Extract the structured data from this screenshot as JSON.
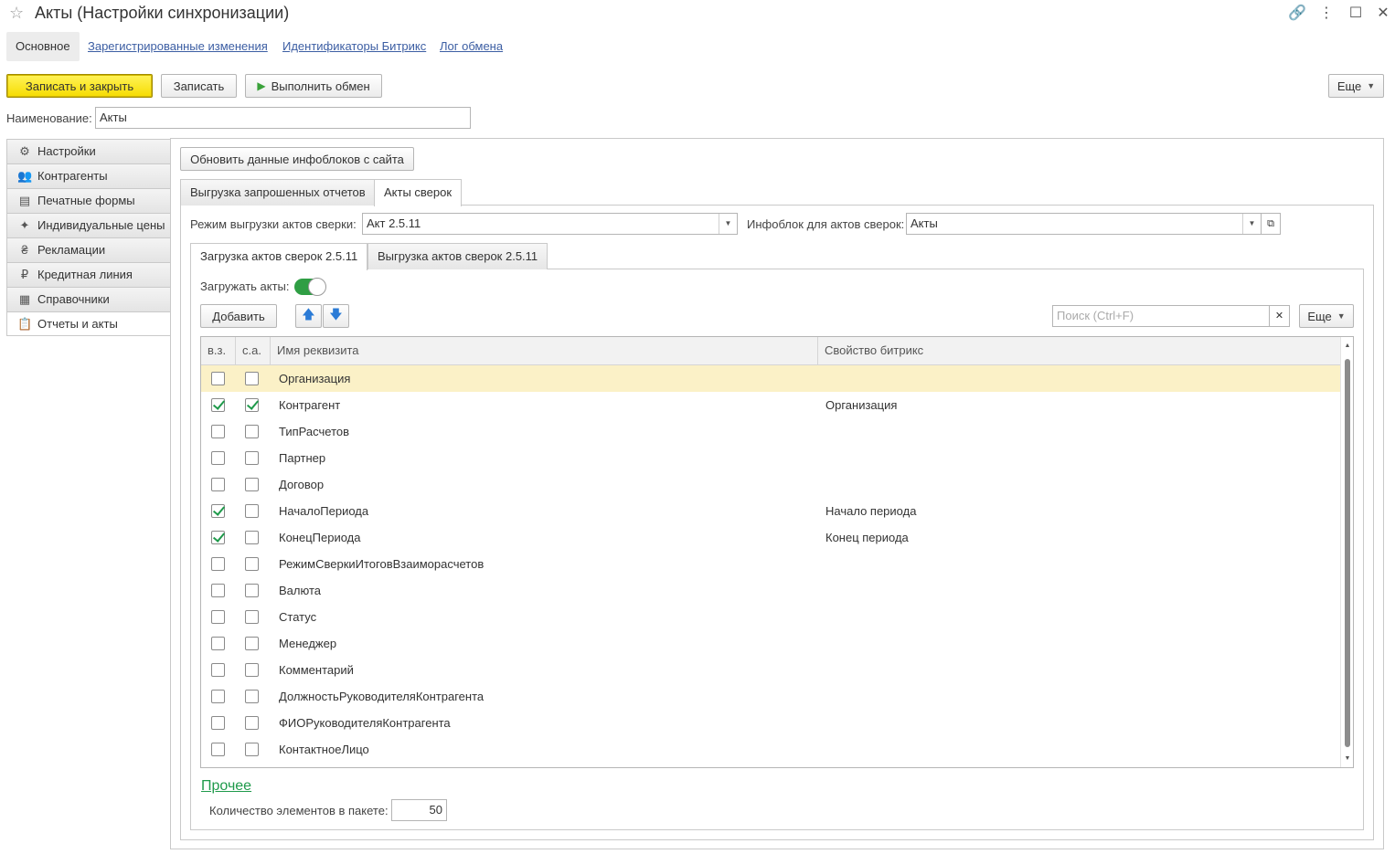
{
  "window": {
    "title": "Акты (Настройки синхронизации)"
  },
  "nav_tabs": [
    {
      "label": "Основное"
    },
    {
      "label": "Зарегистрированные изменения"
    },
    {
      "label": "Идентификаторы Битрикс"
    },
    {
      "label": "Лог обмена"
    }
  ],
  "toolbar": {
    "save_close": "Записать и закрыть",
    "save": "Записать",
    "exchange": "Выполнить обмен",
    "more": "Еще"
  },
  "name_field": {
    "label": "Наименование:",
    "value": "Акты"
  },
  "sidebar": {
    "items": [
      {
        "label": "Настройки",
        "icon": "gear-icon",
        "glyph": "⚙"
      },
      {
        "label": "Контрагенты",
        "icon": "users-icon",
        "glyph": "👥"
      },
      {
        "label": "Печатные формы",
        "icon": "document-icon",
        "glyph": "▤"
      },
      {
        "label": "Индивидуальные цены",
        "icon": "handshake-icon",
        "glyph": "✦"
      },
      {
        "label": "Рекламации",
        "icon": "money-bag-icon",
        "glyph": "₴"
      },
      {
        "label": "Кредитная линия",
        "icon": "ruble-icon",
        "glyph": "₽"
      },
      {
        "label": "Справочники",
        "icon": "table-icon",
        "glyph": "▦"
      },
      {
        "label": "Отчеты и акты",
        "icon": "clipboard-icon",
        "glyph": "📋"
      }
    ],
    "active_index": 7
  },
  "main": {
    "refresh_button": "Обновить данные инфоблоков с сайта",
    "tabs": [
      {
        "label": "Выгрузка запрошенных отчетов"
      },
      {
        "label": "Акты сверок"
      }
    ],
    "mode_label": "Режим выгрузки актов сверки:",
    "mode_value": "Акт 2.5.11",
    "infoblock_label": "Инфоблок для актов сверок:",
    "infoblock_value": "Акты",
    "subtabs": [
      {
        "label": "Загрузка актов сверок 2.5.11"
      },
      {
        "label": "Выгрузка актов сверок 2.5.11"
      }
    ],
    "load_acts_label": "Загружать акты:",
    "load_acts_on": true,
    "add_button": "Добавить",
    "search_placeholder": "Поиск (Ctrl+F)",
    "more": "Еще",
    "table": {
      "columns": [
        "в.з.",
        "с.а.",
        "Имя реквизита",
        "Свойство битрикс"
      ],
      "rows": [
        {
          "vz": false,
          "sa": false,
          "name": "Организация",
          "prop": ""
        },
        {
          "vz": true,
          "sa": true,
          "name": "Контрагент",
          "prop": "Организация"
        },
        {
          "vz": false,
          "sa": false,
          "name": "ТипРасчетов",
          "prop": ""
        },
        {
          "vz": false,
          "sa": false,
          "name": "Партнер",
          "prop": ""
        },
        {
          "vz": false,
          "sa": false,
          "name": "Договор",
          "prop": ""
        },
        {
          "vz": true,
          "sa": false,
          "name": "НачалоПериода",
          "prop": "Начало периода"
        },
        {
          "vz": true,
          "sa": false,
          "name": "КонецПериода",
          "prop": "Конец периода"
        },
        {
          "vz": false,
          "sa": false,
          "name": "РежимСверкиИтоговВзаиморасчетов",
          "prop": ""
        },
        {
          "vz": false,
          "sa": false,
          "name": "Валюта",
          "prop": ""
        },
        {
          "vz": false,
          "sa": false,
          "name": "Статус",
          "prop": ""
        },
        {
          "vz": false,
          "sa": false,
          "name": "Менеджер",
          "prop": ""
        },
        {
          "vz": false,
          "sa": false,
          "name": "Комментарий",
          "prop": ""
        },
        {
          "vz": false,
          "sa": false,
          "name": "ДолжностьРуководителяКонтрагента",
          "prop": ""
        },
        {
          "vz": false,
          "sa": false,
          "name": "ФИОРуководителяКонтрагента",
          "prop": ""
        },
        {
          "vz": false,
          "sa": false,
          "name": "КонтактноеЛицо",
          "prop": ""
        }
      ],
      "selected_index": 0
    },
    "other_link": "Прочее",
    "batch_label": "Количество элементов в пакете:",
    "batch_value": "50"
  }
}
